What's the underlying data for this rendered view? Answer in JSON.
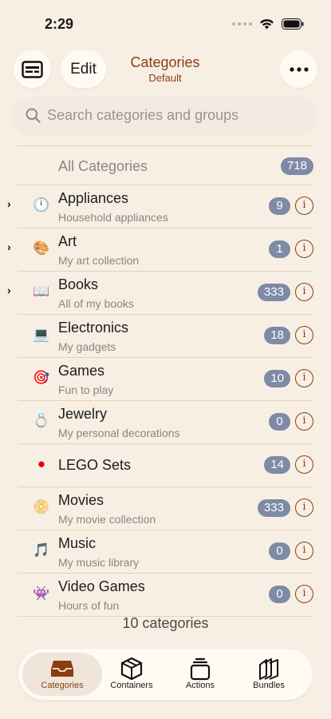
{
  "status_bar": {
    "time": "2:29"
  },
  "header": {
    "edit_label": "Edit",
    "title": "Categories",
    "subtitle": "Default",
    "icons": {
      "left": "card-icon",
      "right": "ellipsis-icon"
    }
  },
  "search": {
    "placeholder": "Search categories and groups",
    "value": ""
  },
  "all_categories": {
    "label": "All Categories",
    "count": "718"
  },
  "categories": [
    {
      "name": "Appliances",
      "subtitle": "Household appliances",
      "count": "9",
      "icon": "🕛",
      "expandable": true
    },
    {
      "name": "Art",
      "subtitle": "My art collection",
      "count": "1",
      "icon": "🎨",
      "expandable": true
    },
    {
      "name": "Books",
      "subtitle": "All of my books",
      "count": "333",
      "icon": "📖",
      "expandable": true
    },
    {
      "name": "Electronics",
      "subtitle": "My gadgets",
      "count": "18",
      "icon": "💻",
      "expandable": false
    },
    {
      "name": "Games",
      "subtitle": "Fun to play",
      "count": "10",
      "icon": "🎯",
      "expandable": false
    },
    {
      "name": "Jewelry",
      "subtitle": "My personal decorations",
      "count": "0",
      "icon": "💍",
      "expandable": false
    },
    {
      "name": "LEGO Sets",
      "subtitle": "",
      "count": "14",
      "icon": "●",
      "expandable": false
    },
    {
      "name": "Movies",
      "subtitle": "My movie collection",
      "count": "333",
      "icon": "📀",
      "expandable": false
    },
    {
      "name": "Music",
      "subtitle": "My music library",
      "count": "0",
      "icon": "🎵",
      "expandable": false
    },
    {
      "name": "Video Games",
      "subtitle": "Hours of fun",
      "count": "0",
      "icon": "👾",
      "expandable": false
    }
  ],
  "footer": {
    "count_text": "10 categories"
  },
  "tabs": [
    {
      "label": "Categories",
      "icon": "tray-icon",
      "active": true
    },
    {
      "label": "Containers",
      "icon": "box-icon",
      "active": false
    },
    {
      "label": "Actions",
      "icon": "stack-icon",
      "active": false
    },
    {
      "label": "Bundles",
      "icon": "bundle-icon",
      "active": false
    }
  ],
  "colors": {
    "accent": "#8a3d12",
    "badge": "#7e8aa6",
    "background": "#f8efe4",
    "divider": "#eccfb4"
  }
}
